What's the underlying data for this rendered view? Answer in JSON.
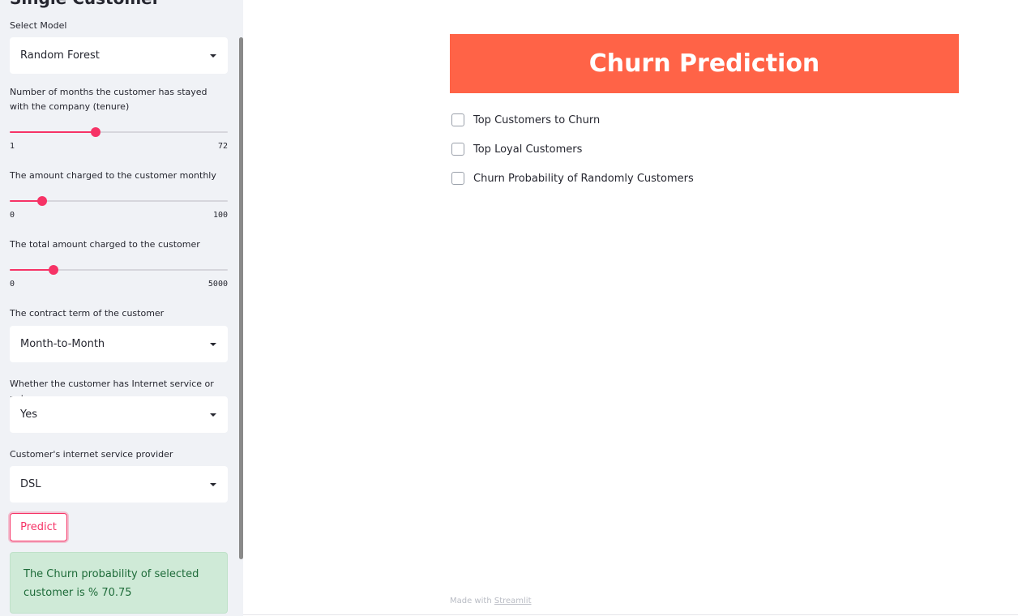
{
  "sidebar": {
    "title": "Single Customer",
    "model": {
      "label": "Select Model",
      "value": "Random Forest"
    },
    "tenure": {
      "label": "Number of months the customer has stayed with the company (tenure)",
      "min": "1",
      "max": "72",
      "value_fraction": 0.395
    },
    "monthly": {
      "label": "The amount charged to the customer monthly",
      "min": "0",
      "max": "100",
      "value_fraction": 0.15
    },
    "total": {
      "label": "The total amount charged to the customer",
      "min": "0",
      "max": "5000",
      "value_fraction": 0.2
    },
    "contract": {
      "label": "The contract term of the customer",
      "value": "Month-to-Month"
    },
    "internet": {
      "label": "Whether the customer has Internet service or not",
      "value": "Yes"
    },
    "provider": {
      "label": "Customer's internet service provider",
      "value": "DSL"
    },
    "predict_label": "Predict",
    "result_text": "The Churn probability of selected customer is % 70.75"
  },
  "main": {
    "title": "Churn Prediction",
    "checkboxes": [
      "Top Customers to Churn",
      "Top Loyal Customers",
      "Churn Probability of Randomly Customers"
    ]
  },
  "footer": {
    "prefix": "Made with",
    "link": "Streamlit"
  },
  "colors": {
    "accent": "#f63366",
    "banner": "#ff6347",
    "sidebar_bg": "#f0f2f6",
    "success_bg": "#cfead7",
    "success_text": "#1e6b39"
  }
}
